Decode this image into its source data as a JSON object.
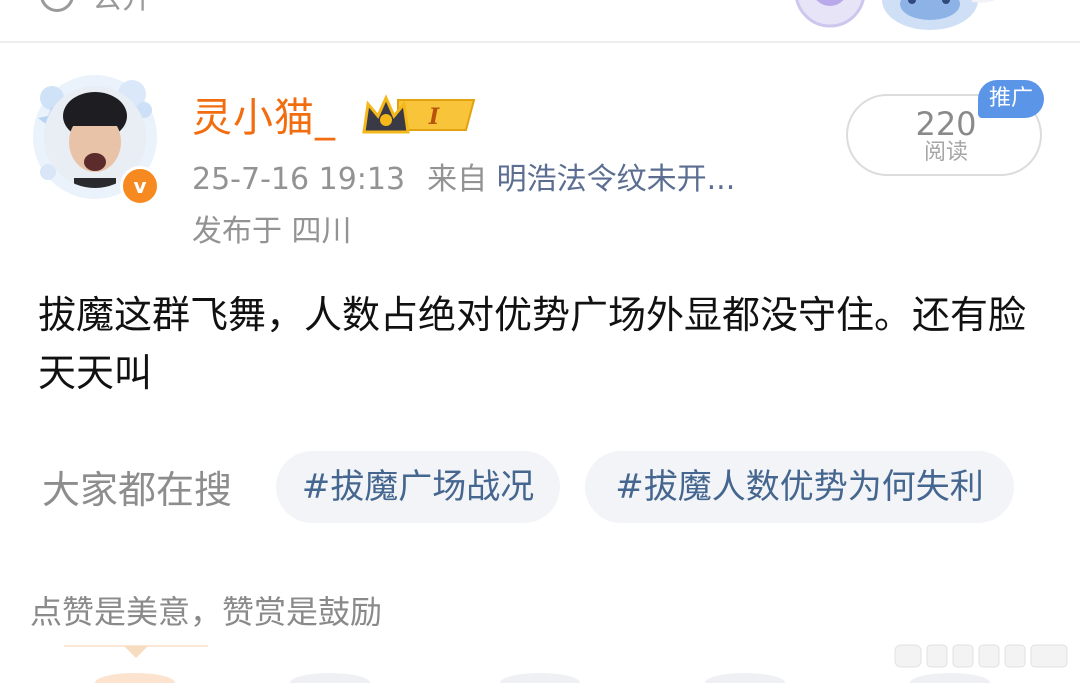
{
  "top_bar": {
    "visibility_label": "公开",
    "visibility_icon": "globe-icon",
    "decoration": "mascot-sticker"
  },
  "author": {
    "name": "灵小猫_",
    "avatar": "user-avatar",
    "verified_badge": "v",
    "member_badge_text": "I",
    "member_badge_icon": "crown-icon"
  },
  "post_meta": {
    "time": "25-7-16 19:13",
    "from_label": "来自",
    "device": "明浩法令纹未开...",
    "location": "发布于 四川"
  },
  "stats": {
    "read_count": "220",
    "read_label": "阅读",
    "promo_tag": "推广"
  },
  "post": {
    "text": "拔魔这群飞舞，人数占绝对优势广场外显都没守住。还有脸天天叫"
  },
  "trending": {
    "label": "大家都在搜",
    "chips": [
      "#拔魔广场战况",
      "#拔魔人数优势为何失利"
    ]
  },
  "footer": {
    "encourage_text": "点赞是美意，赞赏是鼓励"
  },
  "colors": {
    "username": "#f26d10",
    "link": "#5b6e92",
    "chip_text": "#44668f",
    "promo": "#5b95e8",
    "badge_gold": "#f5b81b"
  }
}
